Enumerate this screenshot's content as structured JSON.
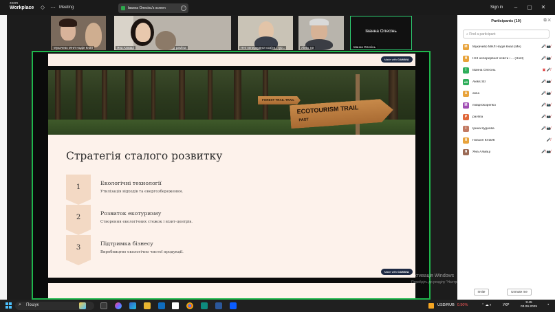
{
  "window": {
    "app_name_top": "zoom",
    "app_name_bottom": "Workplace",
    "meeting_label": "Meeting",
    "share_pill_label": "Іванна Олесінь's screen",
    "signin_label": "Sign in",
    "minimize": "–",
    "restore": "▢",
    "close": "✕"
  },
  "videos": [
    {
      "name": "Мукачево МНЛ Надія Кнап"
    },
    {
      "name": "Яна Алмаці"
    },
    {
      "name": "pavlina"
    },
    {
      "name": "ННІ неперервної освіти і тур..."
    },
    {
      "name": "Aleks Str"
    },
    {
      "name": "Іванна Олесінь",
      "big": "Іванна Олесінь"
    }
  ],
  "slide": {
    "gamma_prefix": "Made with",
    "gamma_brand": "GAMMA",
    "sign_main": "ECOTOURISM TRAIL",
    "sign_sub": "PAST",
    "sign_small": "FOREST TRAIL TRAIL",
    "heading": "Стратегія сталого розвитку",
    "steps": [
      {
        "num": "1",
        "title": "Екологічні технології",
        "desc": "Утилізація відходів та енергозбереження."
      },
      {
        "num": "2",
        "title": "Розвиток екотуризму",
        "desc": "Створення екологічних стежок і візит-центрів."
      },
      {
        "num": "3",
        "title": "Підтримка бізнесу",
        "desc": "Виробництво екологічно чистої продукції."
      }
    ]
  },
  "panel": {
    "title": "Participants (10)",
    "search_placeholder": "Find a participant",
    "participants": [
      {
        "initial": "М",
        "name": "Мукачево МНЛ Надія Кнап (Me)",
        "color": "#e8a33b",
        "icons": "🎤̸ 📷̸"
      },
      {
        "initial": "Н",
        "name": "ННІ неперервної освіти і ... (Host)",
        "color": "#e8a33b",
        "icons": "🎤̸ 📷̸"
      },
      {
        "initial": "І",
        "name": "Іванна Олесінь",
        "color": "#2fae5b",
        "icons": "▣ 🎤̸"
      },
      {
        "initial": "AS",
        "name": "Aleks Str",
        "color": "#2fae5b",
        "icons": "🎤̸ 📷̸"
      },
      {
        "initial": "A",
        "name": "alina",
        "color": "#e8a33b",
        "icons": "🎤̸ 📷̸"
      },
      {
        "initial": "M",
        "name": "milaprokopenko",
        "color": "#a04db3",
        "icons": "🎤̸ 📷̸"
      },
      {
        "initial": "P",
        "name": "pavlina",
        "color": "#e0683a",
        "icons": "🎤̸ 📷̸"
      },
      {
        "initial": "І",
        "name": "Ірина  Куднова",
        "color": "#c27a62",
        "icons": "🎤̸ 📷̸"
      },
      {
        "initial": "Н",
        "name": "Наталя КУЗИК",
        "color": "#e8a33b",
        "icons": "🎤̸"
      },
      {
        "initial": "Я",
        "name": "Яна Алмаці",
        "color": "#9b6a55",
        "icons": "🎤̸ 📷̸"
      }
    ],
    "invite_label": "Invite",
    "unmute_label": "Unmute me"
  },
  "watermark": {
    "line1": "Активація Windows",
    "line2": "Перейдіть до розділу \"Настройки\", щоб активувати Windows."
  },
  "taskbar": {
    "search_label": "Пошук",
    "stock_label": "USD/RUB",
    "stock_change": "0.50%",
    "lang": "УКР",
    "time": "9:45",
    "date": "03.06.2025"
  }
}
